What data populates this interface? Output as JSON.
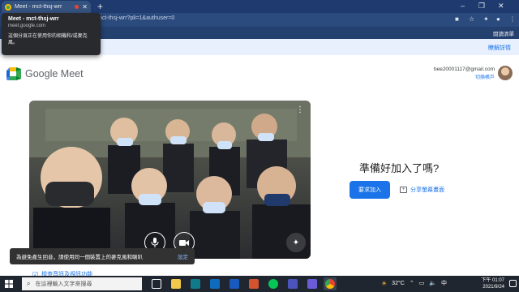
{
  "browser": {
    "tab_title": "Meet - mct-thsj-wrr",
    "url": "mct-thsj-wrr?pli=1&authuser=0",
    "reading_list": "閱讀清單"
  },
  "tooltip": {
    "title": "Meet - mct-thsj-wrr",
    "domain": "meet.google.com",
    "message": "這個分頁正在使用你的相機和/或麥克風。"
  },
  "infostrip": {
    "details_link": "瞭解詳情"
  },
  "meet": {
    "brand": "Google Meet",
    "email": "bee20001117@gmail.com",
    "switch_account": "切換帳戶"
  },
  "join_panel": {
    "heading": "準備好加入了嗎?",
    "join_button": "要求加入",
    "present_button": "分享螢幕畫面"
  },
  "snackbar": {
    "message": "為避免產生回音，請使用同一個裝置上的麥克風和喇叭",
    "action": "設定"
  },
  "check_audio": "檢查音訊及視訊功能",
  "taskbar": {
    "search_placeholder": "在這裡輸入文字來搜尋",
    "temperature": "32°C",
    "time": "下午 01:07",
    "date": "2021/9/24"
  },
  "colors": {
    "accent": "#1a73e8",
    "snackbar": "#323232",
    "taskbar": "#20262f"
  }
}
